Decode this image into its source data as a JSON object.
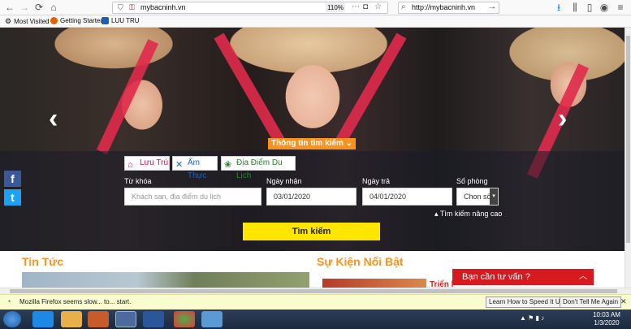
{
  "browser": {
    "url": "mybacninh.vn",
    "zoom": "110%",
    "search_url": "http://mybacninh.vn"
  },
  "bookmarks": [
    "Most Visited",
    "Getting Started",
    "LUU TRU"
  ],
  "hero": {
    "search_title": "Thông tin tìm kiếm",
    "tabs": [
      "Lưu Trú",
      "Ẩm Thực",
      "Địa Điểm Du Lịch"
    ],
    "labels": {
      "keyword": "Từ khóa",
      "checkin": "Ngày nhận",
      "checkout": "Ngày trả",
      "rooms": "Số phòng"
    },
    "keyword_placeholder": "Khách san, địa điểm du lịch",
    "checkin_value": "03/01/2020",
    "checkout_value": "04/01/2020",
    "rooms_value": "Chon số",
    "advanced": "Tìm kiếm nâng cao",
    "search_button": "Tìm kiếm"
  },
  "sections": {
    "news": "Tin Tức",
    "events": "Sự Kiện Nổi Bật",
    "event_item": "Triển l"
  },
  "chat": {
    "label": "Bạn cần tư vấn ?"
  },
  "notification": {
    "message": "Mozilla Firefox seems slow... to... start.",
    "learn_button": "Learn How to Speed It Up",
    "dismiss_button": "Don't Tell Me Again"
  },
  "clock": {
    "time": "10:03 AM",
    "date": "1/3/2020"
  },
  "colors": {
    "accent": "#f7931e",
    "search_button": "#ffe600",
    "chat": "#d71920"
  }
}
